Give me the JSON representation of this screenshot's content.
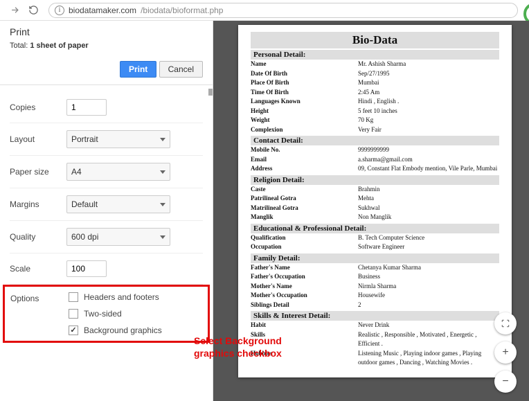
{
  "browser": {
    "url_host": "biodatamaker.com",
    "url_path": "/biodata/bioformat.php"
  },
  "print": {
    "heading": "Print",
    "total_prefix": "Total: ",
    "total_value": "1 sheet of paper",
    "print_btn": "Print",
    "cancel_btn": "Cancel",
    "copies_label": "Copies",
    "copies_value": "1",
    "layout_label": "Layout",
    "layout_value": "Portrait",
    "paper_label": "Paper size",
    "paper_value": "A4",
    "margins_label": "Margins",
    "margins_value": "Default",
    "quality_label": "Quality",
    "quality_value": "600 dpi",
    "scale_label": "Scale",
    "scale_value": "100",
    "options_label": "Options",
    "opt_hf": "Headers and footers",
    "opt_two": "Two-sided",
    "opt_bg": "Background graphics"
  },
  "callout": {
    "line1": "Select Background",
    "line2": "graphics checkbox"
  },
  "doc": {
    "title": "Bio-Data",
    "sections": [
      {
        "header": "Personal Detail:",
        "rows": [
          {
            "k": "Name",
            "v": "Mr. Ashish Sharma"
          },
          {
            "k": "Date Of Birth",
            "v": "Sep/27/1995"
          },
          {
            "k": "Place Of Birth",
            "v": "Mumbai"
          },
          {
            "k": "Time Of Birth",
            "v": "2:45 Am"
          },
          {
            "k": "Languages Known",
            "v": "Hindi , English ."
          },
          {
            "k": "Height",
            "v": "5 feet 10 inches"
          },
          {
            "k": "Weight",
            "v": "70 Kg"
          },
          {
            "k": "Complexion",
            "v": "Very Fair"
          }
        ]
      },
      {
        "header": "Contact Detail:",
        "rows": [
          {
            "k": "Mobile No.",
            "v": "9999999999"
          },
          {
            "k": "Email",
            "v": "a.sharma@gmail.com"
          },
          {
            "k": "Address",
            "v": "09, Constant Flat Embody mention, Vile Parle, Mumbai"
          }
        ]
      },
      {
        "header": "Religion Detail:",
        "rows": [
          {
            "k": "Caste",
            "v": "Brahmin"
          },
          {
            "k": "Patrilineal Gotra",
            "v": "Mehta"
          },
          {
            "k": "Matrilineal Gotra",
            "v": "Sukhwal"
          },
          {
            "k": "Manglik",
            "v": "Non Manglik"
          }
        ]
      },
      {
        "header": "Educational & Professional Detail:",
        "rows": [
          {
            "k": "Qualification",
            "v": "B. Tech Computer Science"
          },
          {
            "k": "Occupation",
            "v": "Software Engineer"
          }
        ]
      },
      {
        "header": "Family Detail:",
        "rows": [
          {
            "k": "Father's Name",
            "v": "Chetanya Kumar Sharma"
          },
          {
            "k": "Father's Occupation",
            "v": "Business"
          },
          {
            "k": "Mother's Name",
            "v": "Nirmla Sharma"
          },
          {
            "k": "Mother's Occupation",
            "v": "Housewife"
          },
          {
            "k": "Siblings Detail",
            "v": "2"
          }
        ]
      },
      {
        "header": "Skills & Interest Detail:",
        "rows": [
          {
            "k": "Habit",
            "v": "Never Drink"
          },
          {
            "k": "Skills",
            "v": "Realistic , Responsible , Motivated , Energetic , Efficient ."
          },
          {
            "k": "Hobbies",
            "v": "Listening Music , Playing indoor games , Playing outdoor games , Dancing , Watching Movies ."
          }
        ]
      }
    ]
  }
}
